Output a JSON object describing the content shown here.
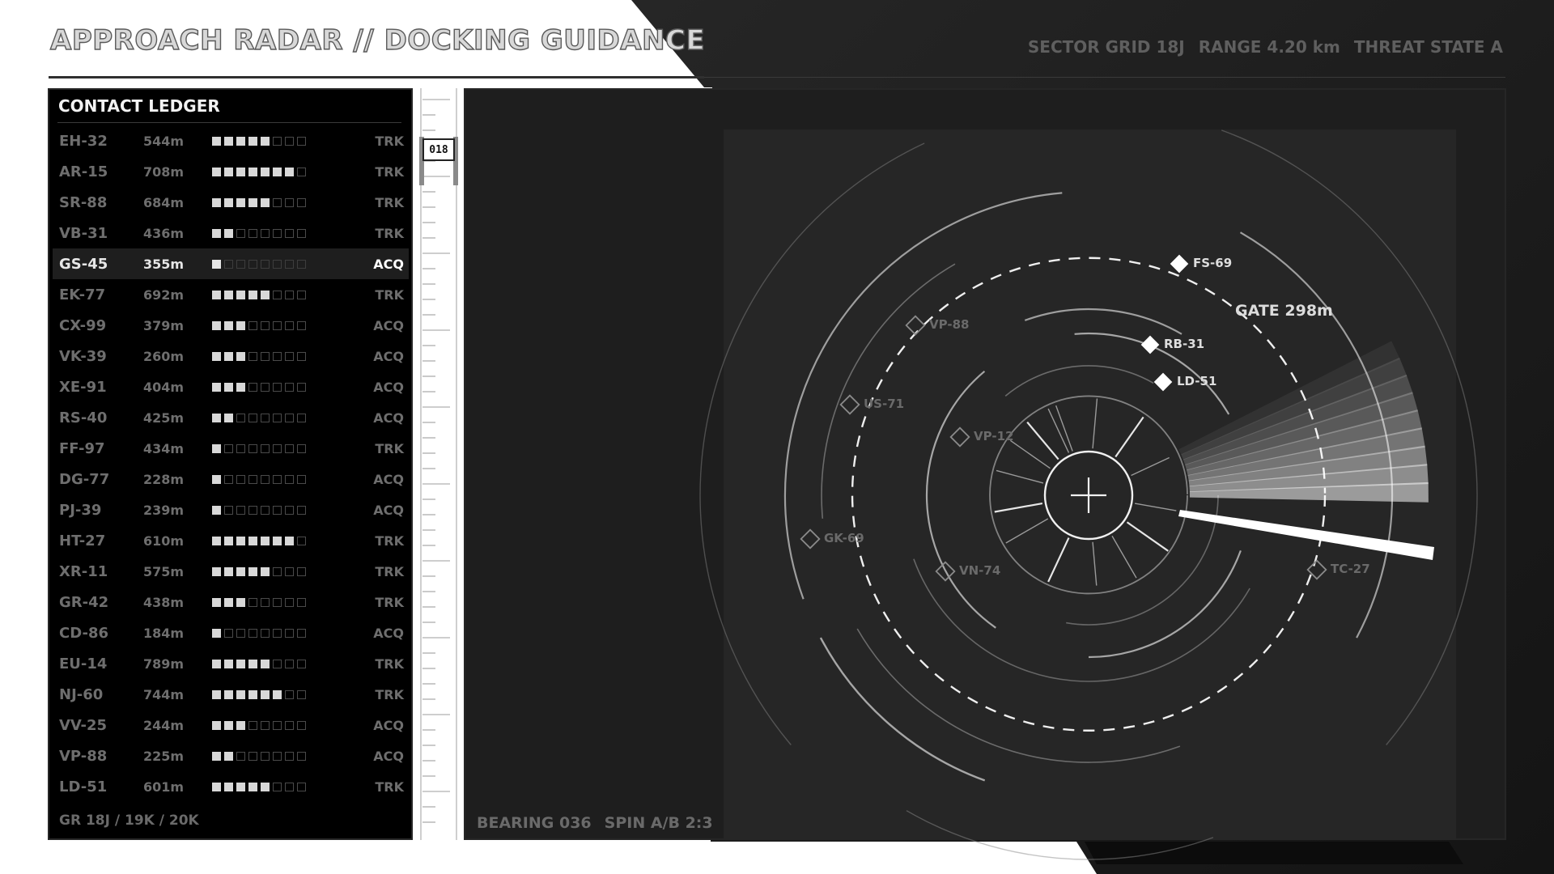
{
  "header": {
    "title": "APPROACH RADAR // DOCKING GUIDANCE",
    "stats": [
      "SECTOR GRID 18J",
      "RANGE 4.20 km",
      "THREAT STATE A"
    ]
  },
  "ledger": {
    "title": "CONTACT LEDGER",
    "signal_max": 8,
    "rows": [
      {
        "id": "EH-32",
        "dist": "544m",
        "signal": 5,
        "state": "TRK"
      },
      {
        "id": "AR-15",
        "dist": "708m",
        "signal": 7,
        "state": "TRK"
      },
      {
        "id": "SR-88",
        "dist": "684m",
        "signal": 5,
        "state": "TRK"
      },
      {
        "id": "VB-31",
        "dist": "436m",
        "signal": 2,
        "state": "TRK"
      },
      {
        "id": "GS-45",
        "dist": "355m",
        "signal": 1,
        "state": "ACQ",
        "selected": true
      },
      {
        "id": "EK-77",
        "dist": "692m",
        "signal": 5,
        "state": "TRK"
      },
      {
        "id": "CX-99",
        "dist": "379m",
        "signal": 3,
        "state": "ACQ"
      },
      {
        "id": "VK-39",
        "dist": "260m",
        "signal": 3,
        "state": "ACQ"
      },
      {
        "id": "XE-91",
        "dist": "404m",
        "signal": 3,
        "state": "ACQ"
      },
      {
        "id": "RS-40",
        "dist": "425m",
        "signal": 2,
        "state": "ACQ"
      },
      {
        "id": "FF-97",
        "dist": "434m",
        "signal": 1,
        "state": "TRK"
      },
      {
        "id": "DG-77",
        "dist": "228m",
        "signal": 1,
        "state": "ACQ"
      },
      {
        "id": "PJ-39",
        "dist": "239m",
        "signal": 1,
        "state": "ACQ"
      },
      {
        "id": "HT-27",
        "dist": "610m",
        "signal": 7,
        "state": "TRK"
      },
      {
        "id": "XR-11",
        "dist": "575m",
        "signal": 5,
        "state": "TRK"
      },
      {
        "id": "GR-42",
        "dist": "438m",
        "signal": 3,
        "state": "TRK"
      },
      {
        "id": "CD-86",
        "dist": "184m",
        "signal": 1,
        "state": "ACQ"
      },
      {
        "id": "EU-14",
        "dist": "789m",
        "signal": 5,
        "state": "TRK"
      },
      {
        "id": "NJ-60",
        "dist": "744m",
        "signal": 6,
        "state": "TRK"
      },
      {
        "id": "VV-25",
        "dist": "244m",
        "signal": 3,
        "state": "ACQ"
      },
      {
        "id": "VP-88",
        "dist": "225m",
        "signal": 2,
        "state": "ACQ"
      },
      {
        "id": "LD-51",
        "dist": "601m",
        "signal": 5,
        "state": "TRK"
      }
    ],
    "footer": "GR 18J / 19K / 20K"
  },
  "scale": {
    "bearing_marker": "018"
  },
  "radar": {
    "gate_label": "GATE 298m",
    "footer": [
      "BEARING 036",
      "SPIN A/B 2:3"
    ],
    "contacts": [
      {
        "id": "FS-69",
        "style": "solid"
      },
      {
        "id": "RB-31",
        "style": "solid"
      },
      {
        "id": "LD-51",
        "style": "solid"
      },
      {
        "id": "VP-88",
        "style": "hollow"
      },
      {
        "id": "US-71",
        "style": "hollow"
      },
      {
        "id": "VP-12",
        "style": "hollow"
      },
      {
        "id": "GK-69",
        "style": "hollow"
      },
      {
        "id": "VN-74",
        "style": "hollow"
      },
      {
        "id": "TC-27",
        "style": "hollow"
      }
    ]
  },
  "colors": {
    "panel": "#1e1e1e",
    "ledger_bg": "#000000",
    "accent": "#ffffff",
    "dim_text": "#6e6e6e"
  }
}
